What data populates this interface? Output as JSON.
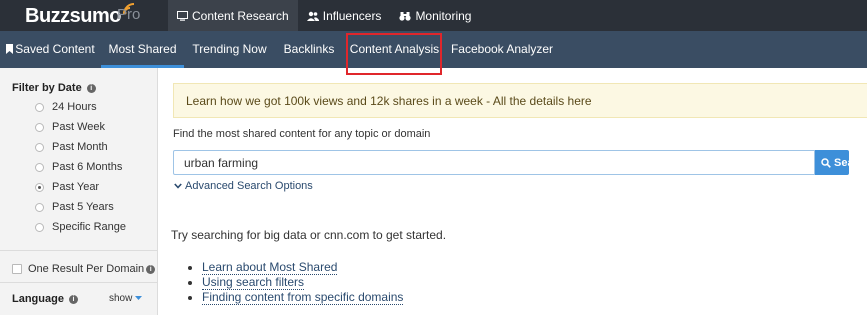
{
  "header": {
    "logo": "Buzzsumo",
    "plan": "Pro",
    "nav": [
      {
        "label": "Content Research",
        "icon": "monitor-icon"
      },
      {
        "label": "Influencers",
        "icon": "users-icon"
      },
      {
        "label": "Monitoring",
        "icon": "binoculars-icon"
      }
    ]
  },
  "subnav": {
    "items": [
      {
        "label": "Saved Content",
        "icon": "bookmark-icon"
      },
      {
        "label": "Most Shared"
      },
      {
        "label": "Trending Now"
      },
      {
        "label": "Backlinks"
      },
      {
        "label": "Content Analysis"
      },
      {
        "label": "Facebook Analyzer"
      }
    ],
    "active": "Most Shared",
    "highlighted": "Content Analysis"
  },
  "sidebar": {
    "filter_heading": "Filter by Date",
    "date_options": [
      "24 Hours",
      "Past Week",
      "Past Month",
      "Past 6 Months",
      "Past Year",
      "Past 5 Years",
      "Specific Range"
    ],
    "selected_date": "Past Year",
    "one_result_label": "One Result Per Domain",
    "language_heading": "Language",
    "show_label": "show"
  },
  "main": {
    "banner": "Learn how we got 100k views and 12k shares in a week - All the details here",
    "search_hint": "Find the most shared content for any topic or domain",
    "search_value": "urban farming",
    "search_button": "Search!",
    "advanced_options": "Advanced Search Options",
    "try_prefix": "Try searching for ",
    "try_example1": "big data",
    "try_or": " or ",
    "try_example2": "cnn.com",
    "try_suffix": " to get started.",
    "links": [
      "Learn about Most Shared",
      "Using search filters",
      "Finding content from specific domains"
    ]
  },
  "colors": {
    "topbar": "#2b3038",
    "subnav": "#3a4d63",
    "accent": "#3d8fd9",
    "highlight": "#e0262b",
    "banner": "#fcf8e3"
  }
}
